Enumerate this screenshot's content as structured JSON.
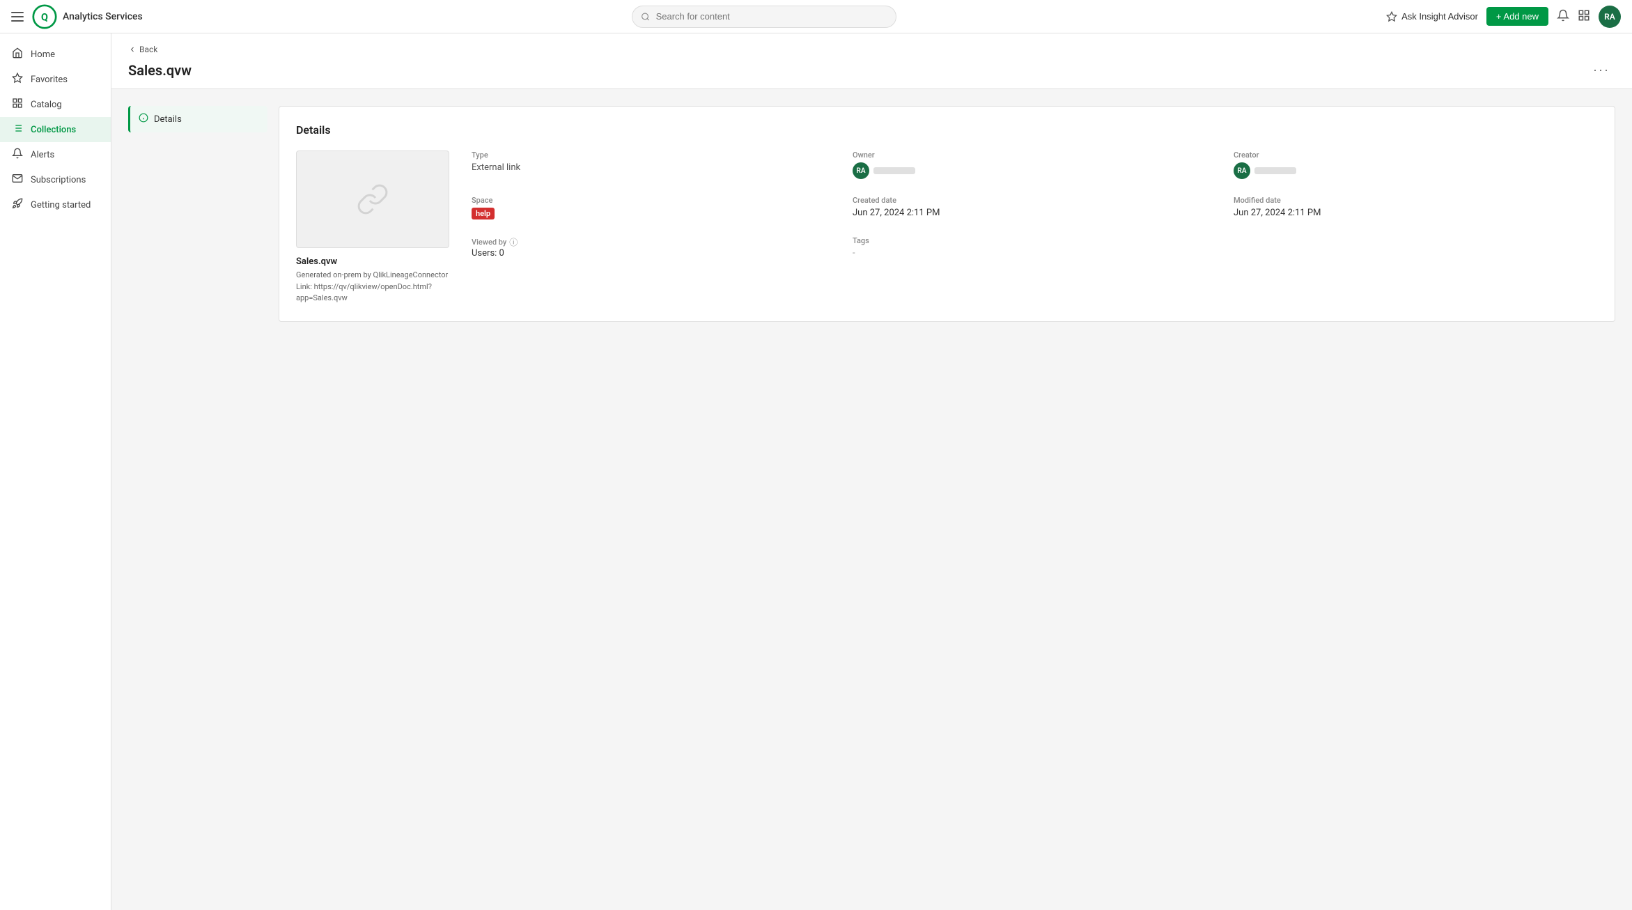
{
  "topnav": {
    "app_title": "Analytics Services",
    "search_placeholder": "Search for content",
    "insight_advisor_label": "Ask Insight Advisor",
    "add_new_label": "+ Add new",
    "avatar_initials": "RA"
  },
  "sidebar": {
    "items": [
      {
        "id": "home",
        "label": "Home",
        "icon": "🏠"
      },
      {
        "id": "favorites",
        "label": "Favorites",
        "icon": "☆"
      },
      {
        "id": "catalog",
        "label": "Catalog",
        "icon": "📋"
      },
      {
        "id": "collections",
        "label": "Collections",
        "icon": "▤",
        "active": true
      },
      {
        "id": "alerts",
        "label": "Alerts",
        "icon": "🔔"
      },
      {
        "id": "subscriptions",
        "label": "Subscriptions",
        "icon": "✉"
      },
      {
        "id": "getting_started",
        "label": "Getting started",
        "icon": "🚀"
      }
    ]
  },
  "page": {
    "back_label": "Back",
    "title": "Sales.qvw",
    "left_nav": [
      {
        "id": "details",
        "label": "Details",
        "active": true
      }
    ],
    "details_section_title": "Details",
    "file": {
      "name": "Sales.qvw",
      "description": "Generated on-prem by QlikLineageConnector Link: https://qv/qlikview/openDoc.html?app=Sales.qvw"
    },
    "metadata": {
      "type_label": "Type",
      "type_value": "External link",
      "owner_label": "Owner",
      "owner_initials": "RA",
      "creator_label": "Creator",
      "creator_initials": "RA",
      "space_label": "Space",
      "space_value": "help",
      "created_date_label": "Created date",
      "created_date_value": "Jun 27, 2024 2:11 PM",
      "modified_date_label": "Modified date",
      "modified_date_value": "Jun 27, 2024 2:11 PM",
      "viewed_by_label": "Viewed by",
      "users_value": "Users: 0",
      "tags_label": "Tags",
      "tags_value": "-"
    }
  }
}
